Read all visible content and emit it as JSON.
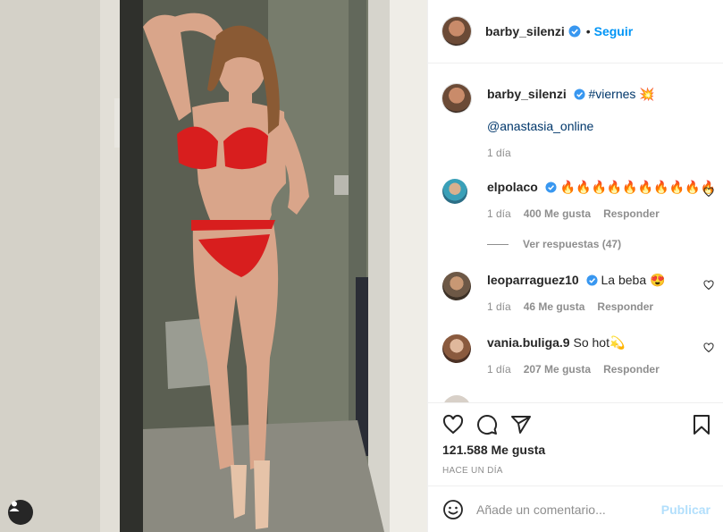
{
  "post": {
    "username": "barby_silenzi",
    "follow_label": "Seguir",
    "separator": "•",
    "caption_hashtag": "#viernes",
    "caption_emoji": "💥",
    "caption_mention": "@anastasia_online",
    "caption_time": "1 día"
  },
  "comments": [
    {
      "username": "elpolaco",
      "verified": true,
      "text": "🔥🔥🔥🔥🔥🔥🔥🔥🔥🔥",
      "time": "1 día",
      "likes": "400 Me gusta",
      "reply": "Responder"
    },
    {
      "username": "leoparraguez10",
      "verified": true,
      "text": "La beba 😍",
      "time": "1 día",
      "likes": "46 Me gusta",
      "reply": "Responder"
    },
    {
      "username": "vania.buliga.9",
      "verified": false,
      "text": "So hot💫",
      "time": "1 día",
      "likes": "207 Me gusta",
      "reply": "Responder"
    }
  ],
  "view_replies": "Ver respuestas (47)",
  "stats": {
    "likes": "121.588 Me gusta",
    "posted": "Hace un día"
  },
  "add_comment": {
    "placeholder": "Añade un comentario...",
    "publish": "Publicar"
  },
  "colors": {
    "accent": "#0095f6",
    "verified": "#3897f0",
    "publish_disabled": "#b2dffc"
  },
  "icons": [
    "heart-icon",
    "comment-icon",
    "share-icon",
    "save-icon",
    "emoji-icon",
    "user-tag-icon",
    "verified-icon"
  ]
}
